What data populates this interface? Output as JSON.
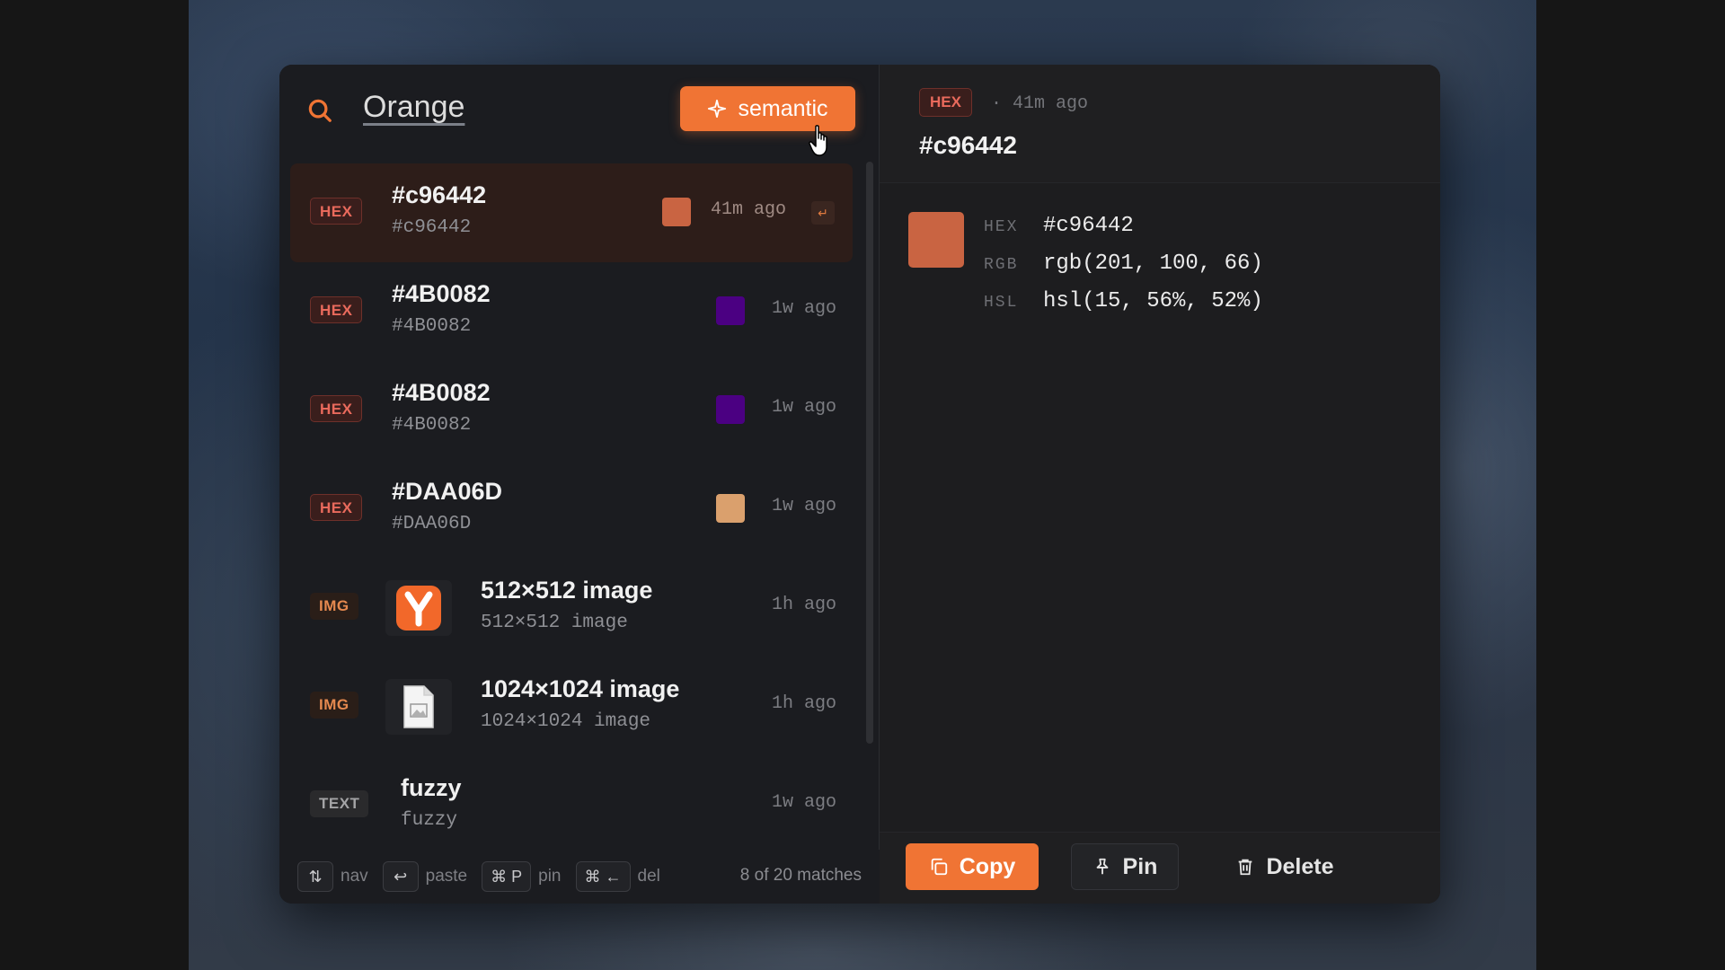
{
  "search": {
    "query": "Orange",
    "mode_button": "semantic"
  },
  "items": [
    {
      "badge": "HEX",
      "type": "hex",
      "title": "#c96442",
      "subtitle": "#c96442",
      "swatch": "#c96442",
      "time": "41m ago",
      "selected": true
    },
    {
      "badge": "HEX",
      "type": "hex",
      "title": "#4B0082",
      "subtitle": "#4B0082",
      "swatch": "#4B0082",
      "time": "1w ago"
    },
    {
      "badge": "HEX",
      "type": "hex",
      "title": "#4B0082",
      "subtitle": "#4B0082",
      "swatch": "#4B0082",
      "time": "1w ago"
    },
    {
      "badge": "HEX",
      "type": "hex",
      "title": "#DAA06D",
      "subtitle": "#DAA06D",
      "swatch": "#DAA06D",
      "time": "1w ago"
    },
    {
      "badge": "IMG",
      "type": "img",
      "title": "512×512 image",
      "subtitle": "512×512 image",
      "thumb_icon": "y-logo-icon",
      "time": "1h ago"
    },
    {
      "badge": "IMG",
      "type": "img",
      "title": "1024×1024 image",
      "subtitle": "1024×1024 image",
      "thumb_icon": "file-image-icon",
      "time": "1h ago"
    },
    {
      "badge": "TEXT",
      "type": "text",
      "title": "fuzzy",
      "subtitle": "fuzzy",
      "time": "1w ago"
    }
  ],
  "footer": {
    "hints": [
      {
        "key": "⇅",
        "label": "nav"
      },
      {
        "key": "↩",
        "label": "paste"
      },
      {
        "key": "⌘ P",
        "label": "pin"
      },
      {
        "key": "⌘ ←",
        "label": "del"
      }
    ],
    "match_count": "8 of 20 matches"
  },
  "detail": {
    "badge": "HEX",
    "time": "· 41m ago",
    "title": "#c96442",
    "swatch": "#c96442",
    "fields": [
      {
        "key": "HEX",
        "value": "#c96442"
      },
      {
        "key": "RGB",
        "value": "rgb(201, 100, 66)"
      },
      {
        "key": "HSL",
        "value": "hsl(15, 56%, 52%)"
      }
    ]
  },
  "actions": {
    "copy": "Copy",
    "pin": "Pin",
    "delete": "Delete"
  },
  "colors": {
    "accent": "#f07434",
    "selected_row": "#2d1d19",
    "hex_badge": "#e96a5c"
  }
}
